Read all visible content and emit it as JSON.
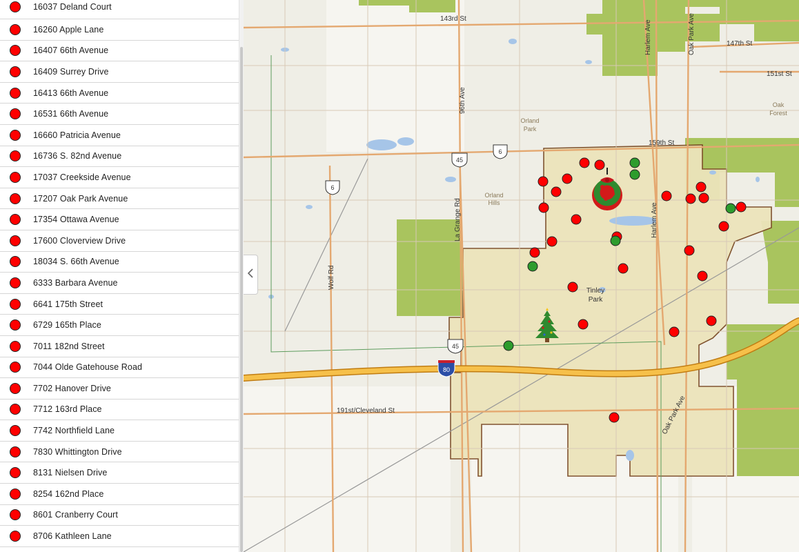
{
  "addresses": [
    "16037 Deland Court",
    "16260 Apple Lane",
    "16407 66th Avenue",
    "16409 Surrey Drive",
    "16413 66th Avenue",
    "16531 66th Avenue",
    "16660 Patricia Avenue",
    "16736 S. 82nd Avenue",
    "17037 Creekside Avenue",
    "17207 Oak Park Avenue",
    "17354 Ottawa Avenue",
    "17600 Cloverview Drive",
    "18034 S. 66th Avenue",
    "6333 Barbara Avenue",
    "6641 175th Street",
    "6729 165th Place",
    "7011 182nd Street",
    "7044 Olde Gatehouse Road",
    "7702 Hanover Drive",
    "7712 163rd Place",
    "7742 Northfield Lane",
    "7830 Whittington Drive",
    "8131 Nielsen Drive",
    "8254 162nd Place",
    "8601 Cranberry Court",
    "8706 Kathleen Lane"
  ],
  "map": {
    "road_labels": {
      "s143": "143rd St",
      "s147": "147th St",
      "s151": "151st St",
      "s159": "159th St",
      "harlem": "Harlem Ave",
      "harlem2": "Harlem Ave",
      "oakpark": "Oak Park Ave",
      "oakpark2": "Oak Park Ave",
      "ave96": "96th Ave",
      "lagrange": "La Grange Rd",
      "wolf": "Wolf Rd",
      "cleveland": "191st/Cleveland St"
    },
    "place_labels": {
      "orland_park_1": "Orland",
      "orland_park_2": "Park",
      "orland_hills_1": "Orland",
      "orland_hills_2": "Hills",
      "tinley_1": "Tinley",
      "tinley_2": "Park",
      "oak_forest_1": "Oak",
      "oak_forest_2": "Forest"
    },
    "shields": {
      "us6_a": "6",
      "us6_b": "6",
      "us45_a": "45",
      "us45_b": "45",
      "i80": "80"
    },
    "colors": {
      "red_marker": "#ff0000",
      "green_marker": "#2d9c2d",
      "boundary_fill": "#ece4bb",
      "park": "#a9c45e",
      "highway": "#f1b12c",
      "arterial": "#e4a870"
    },
    "icons": [
      "wreath-icon",
      "christmas-tree-icon"
    ]
  }
}
